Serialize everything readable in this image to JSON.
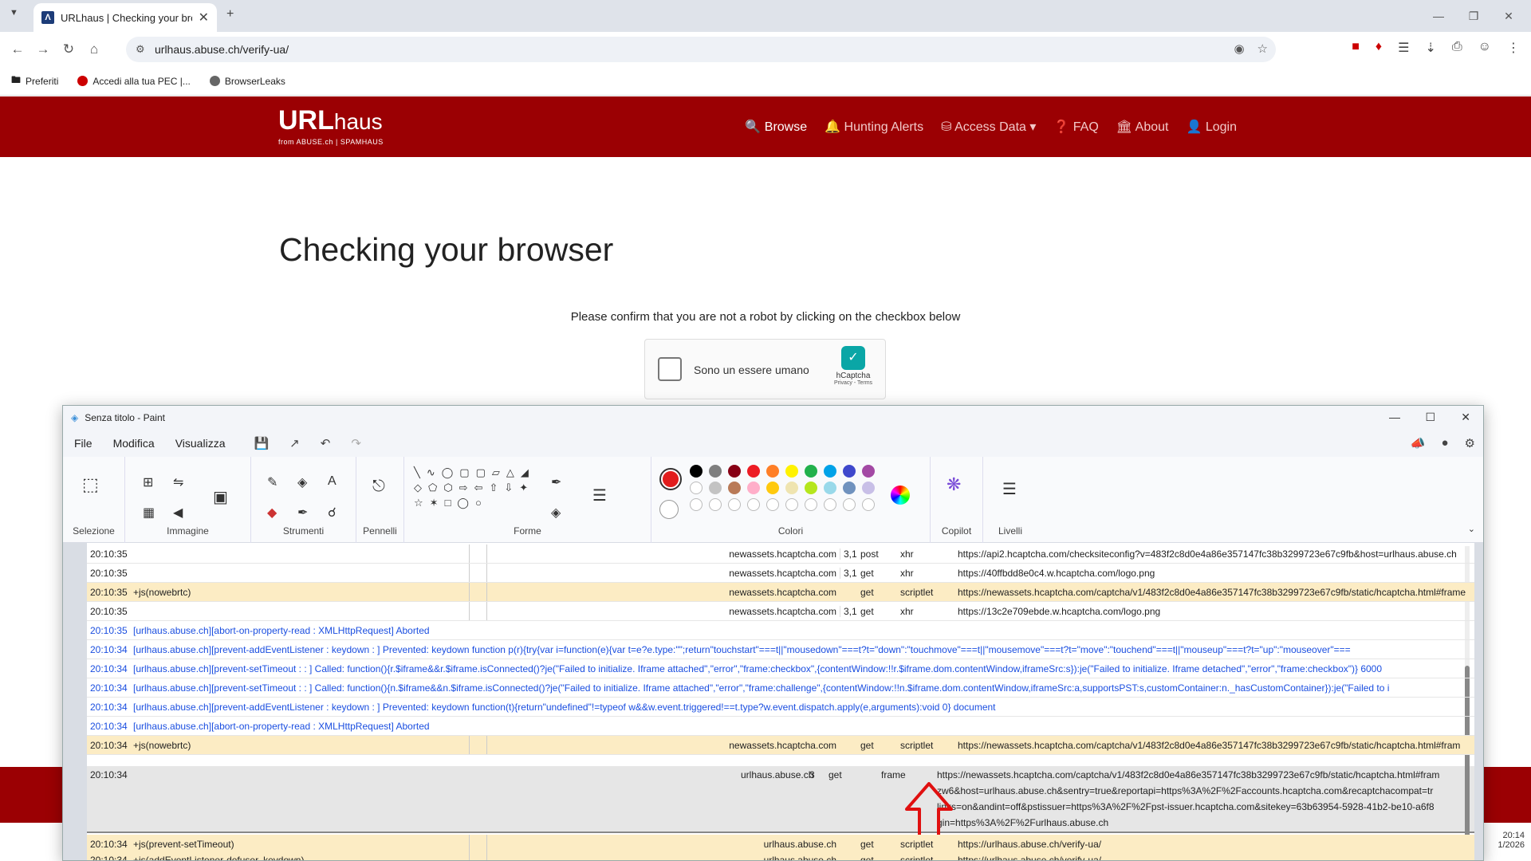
{
  "browser": {
    "tab_title": "URLhaus | Checking your browser",
    "url": "urlhaus.abuse.ch/verify-ua/",
    "bookmarks": [
      "Preferiti",
      "Accedi alla tua PEC |...",
      "BrowserLeaks"
    ]
  },
  "site": {
    "logo_main": "URL",
    "logo_sub": "haus",
    "logo_from": "from ABUSE.ch | SPAMHAUS",
    "nav": [
      "Browse",
      "Hunting Alerts",
      "Access Data",
      "FAQ",
      "About",
      "Login"
    ],
    "heading": "Checking your browser",
    "instruction": "Please confirm that you are not a robot by clicking on the checkbox below"
  },
  "captcha": {
    "label": "Sono un essere umano",
    "brand": "hCaptcha",
    "links": "Privacy - Terms"
  },
  "paint": {
    "title": "Senza titolo - Paint",
    "menu": [
      "File",
      "Modifica",
      "Visualizza"
    ],
    "groups": [
      "Selezione",
      "Immagine",
      "Strumenti",
      "Pennelli",
      "Forme",
      "Colori",
      "Copilot",
      "Livelli"
    ],
    "colors": {
      "primary": "#e21c1c",
      "row1": [
        "#000000",
        "#7f7f7f",
        "#880015",
        "#ed1c24",
        "#ff7f27",
        "#fff200",
        "#22b14c",
        "#00a2e8",
        "#3f48cc",
        "#a349a4"
      ],
      "row2": [
        "#ffffff",
        "#c3c3c3",
        "#b97a57",
        "#ffaec9",
        "#ffc90e",
        "#efe4b0",
        "#b5e61d",
        "#99d9ea",
        "#7092be",
        "#c8bfe7"
      ]
    }
  },
  "log_rows": [
    {
      "time": "20:10:35",
      "filter": "",
      "domain": "newassets.hcaptcha.com",
      "n": "3,1",
      "method": "post",
      "type": "xhr",
      "url": "https://api2.hcaptcha.com/checksiteconfig?v=483f2c8d0e4a86e357147fc38b3299723e67c9fb&host=urlhaus.abuse.ch",
      "style": "w"
    },
    {
      "time": "20:10:35",
      "filter": "",
      "domain": "newassets.hcaptcha.com",
      "n": "3,1",
      "method": "get",
      "type": "xhr",
      "url": "https://40ffbdd8e0c4.w.hcaptcha.com/logo.png",
      "style": "w"
    },
    {
      "time": "20:10:35",
      "filter": "+js(nowebrtc)",
      "domain": "newassets.hcaptcha.com",
      "n": "",
      "method": "get",
      "type": "scriptlet",
      "url": "https://newassets.hcaptcha.com/captcha/v1/483f2c8d0e4a86e357147fc38b3299723e67c9fb/static/hcaptcha.html#frame",
      "style": "y"
    },
    {
      "time": "20:10:35",
      "filter": "",
      "domain": "newassets.hcaptcha.com",
      "n": "3,1",
      "method": "get",
      "type": "xhr",
      "url": "https://13c2e709ebde.w.hcaptcha.com/logo.png",
      "style": "w"
    },
    {
      "time": "20:10:35",
      "text": "[urlhaus.abuse.ch][abort-on-property-read : XMLHttpRequest] Aborted",
      "style": "b"
    },
    {
      "time": "20:10:34",
      "text": "[urlhaus.abuse.ch][prevent-addEventListener : keydown : ] Prevented: keydown function p(r){try{var i=function(e){var t=e?e.type:\"\";return\"touchstart\"===t||\"mousedown\"===t?t=\"down\":\"touchmove\"===t||\"mousemove\"===t?t=\"move\":\"touchend\"===t||\"mouseup\"===t?t=\"up\":\"mouseover\"===",
      "style": "b"
    },
    {
      "time": "20:10:34",
      "text": "[urlhaus.abuse.ch][prevent-setTimeout : : ] Called: function(){r.$iframe&&r.$iframe.isConnected()?je(\"Failed to initialize. Iframe attached\",\"error\",\"frame:checkbox\",{contentWindow:!!r.$iframe.dom.contentWindow,iframeSrc:s}):je(\"Failed to initialize. Iframe detached\",\"error\",\"frame:checkbox\")} 6000",
      "style": "b"
    },
    {
      "time": "20:10:34",
      "text": "[urlhaus.abuse.ch][prevent-setTimeout : : ] Called: function(){n.$iframe&&n.$iframe.isConnected()?je(\"Failed to initialize. Iframe attached\",\"error\",\"frame:challenge\",{contentWindow:!!n.$iframe.dom.contentWindow,iframeSrc:a,supportsPST:s,customContainer:n._hasCustomContainer}):je(\"Failed to i",
      "style": "b"
    },
    {
      "time": "20:10:34",
      "text": "[urlhaus.abuse.ch][prevent-addEventListener : keydown : ] Prevented: keydown function(t){return\"undefined\"!=typeof w&&w.event.triggered!==t.type?w.event.dispatch.apply(e,arguments):void 0} document",
      "style": "b"
    },
    {
      "time": "20:10:34",
      "text": "[urlhaus.abuse.ch][abort-on-property-read : XMLHttpRequest] Aborted",
      "style": "b"
    },
    {
      "time": "20:10:34",
      "filter": "+js(nowebrtc)",
      "domain": "newassets.hcaptcha.com",
      "n": "",
      "method": "get",
      "type": "scriptlet",
      "url": "https://newassets.hcaptcha.com/captcha/v1/483f2c8d0e4a86e357147fc38b3299723e67c9fb/static/hcaptcha.html#fram",
      "style": "y"
    }
  ],
  "big_row": {
    "time": "20:10:34",
    "domain": "urlhaus.abuse.ch",
    "n": "3",
    "method": "get",
    "type": "frame",
    "lines": [
      "https://newassets.hcaptcha.com/captcha/v1/483f2c8d0e4a86e357147fc38b3299723e67c9fb/static/hcaptcha.html#fram",
      "zw6&host=urlhaus.abuse.ch&sentry=true&reportapi=https%3A%2F%2Faccounts.hcaptcha.com&recaptchacompat=tr",
      "links=on&andint=off&pstissuer=https%3A%2F%2Fpst-issuer.hcaptcha.com&sitekey=63b63954-5928-41b2-be10-a6f8",
      "gin=https%3A%2F%2Furlhaus.abuse.ch"
    ]
  },
  "tail_rows": [
    {
      "time": "20:10:34",
      "filter": "+js(prevent-setTimeout)",
      "domain": "urlhaus.abuse.ch",
      "method": "get",
      "type": "scriptlet",
      "url": "https://urlhaus.abuse.ch/verify-ua/"
    },
    {
      "time": "20:10:34",
      "filter": "+js(addEventListener-defuser, keydown)",
      "domain": "urlhaus.abuse.ch",
      "method": "get",
      "type": "scriptlet",
      "url": "https://urlhaus.abuse.ch/verify-ua/"
    }
  ],
  "taskbar": {
    "time": "20:14",
    "date": "1/2026"
  }
}
